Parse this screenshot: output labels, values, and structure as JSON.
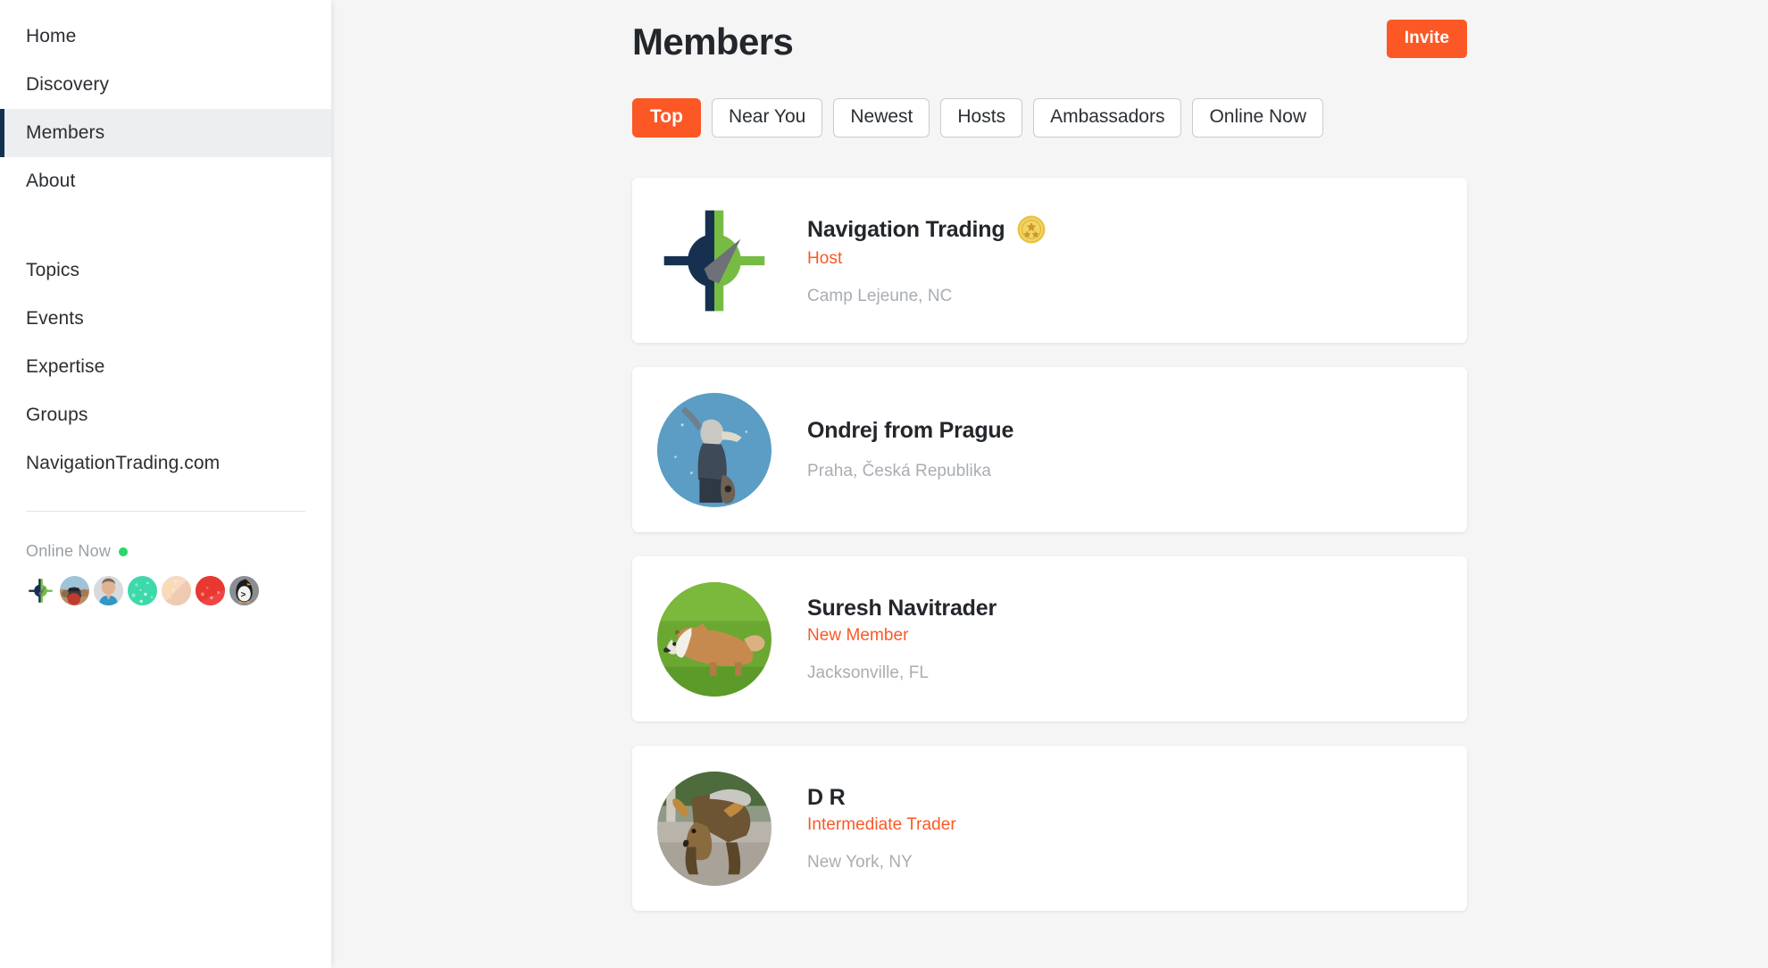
{
  "sidebar": {
    "primary_nav": [
      {
        "label": "Home",
        "active": false
      },
      {
        "label": "Discovery",
        "active": false
      },
      {
        "label": "Members",
        "active": true
      },
      {
        "label": "About",
        "active": false
      }
    ],
    "secondary_nav": [
      {
        "label": "Topics"
      },
      {
        "label": "Events"
      },
      {
        "label": "Expertise"
      },
      {
        "label": "Groups"
      },
      {
        "label": "NavigationTrading.com"
      }
    ],
    "online": {
      "label": "Online Now",
      "dot_color": "#2bd66a",
      "avatars": [
        {
          "name": "compass-logo-avatar"
        },
        {
          "name": "beach-photo-avatar"
        },
        {
          "name": "man-portrait-avatar"
        },
        {
          "name": "teal-pattern-avatar"
        },
        {
          "name": "peach-pattern-avatar"
        },
        {
          "name": "red-pattern-avatar"
        },
        {
          "name": "penguin-terminal-avatar"
        }
      ]
    }
  },
  "header": {
    "title": "Members",
    "invite_label": "Invite"
  },
  "filters": [
    {
      "label": "Top",
      "active": true
    },
    {
      "label": "Near You",
      "active": false
    },
    {
      "label": "Newest",
      "active": false
    },
    {
      "label": "Hosts",
      "active": false
    },
    {
      "label": "Ambassadors",
      "active": false
    },
    {
      "label": "Online Now",
      "active": false
    }
  ],
  "members": [
    {
      "name": "Navigation Trading",
      "role": "Host",
      "location": "Camp Lejeune, NC",
      "badge": "gold-star-medal-icon",
      "avatar": "compass-logo"
    },
    {
      "name": "Ondrej from Prague",
      "role": "",
      "location": "Praha, Česká Republika",
      "badge": "",
      "avatar": "statue-photo"
    },
    {
      "name": "Suresh Navitrader",
      "role": "New Member",
      "location": "Jacksonville, FL",
      "badge": "",
      "avatar": "collie-dog-photo"
    },
    {
      "name": "D R",
      "role": "Intermediate Trader",
      "location": "New York, NY",
      "badge": "",
      "avatar": "charging-bull-photo"
    }
  ],
  "theme": {
    "accent": "#fb5826",
    "navy": "#15314f",
    "green": "#76bc43",
    "page_bg": "#f5f5f6",
    "muted_text": "#a9adb2"
  }
}
